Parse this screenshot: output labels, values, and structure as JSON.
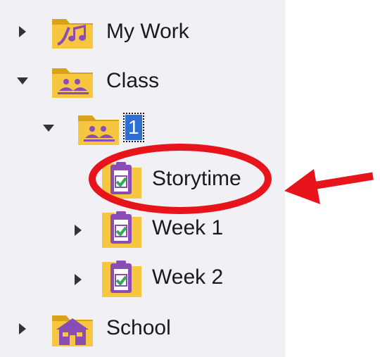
{
  "tree": {
    "items": [
      {
        "label": "My Work",
        "icon": "art-folder-icon",
        "expanded": false
      },
      {
        "label": "Class",
        "icon": "class-folder-icon",
        "expanded": true
      },
      {
        "label": "1",
        "icon": "class-folder-icon",
        "expanded": true,
        "selected": true
      },
      {
        "label": "Storytime",
        "icon": "assignment-clipboard-icon"
      },
      {
        "label": "Week 1",
        "icon": "assignment-clipboard-icon",
        "expanded": false
      },
      {
        "label": "Week 2",
        "icon": "assignment-clipboard-icon",
        "expanded": false
      },
      {
        "label": "School",
        "icon": "school-folder-icon",
        "expanded": false
      }
    ]
  },
  "annotation": {
    "color": "#e8141b",
    "shapes": [
      "highlight-ellipse",
      "pointer-arrow"
    ]
  },
  "colors": {
    "folder": "#f6c640",
    "folder_dark": "#d9a21a",
    "purple": "#8a4cb5",
    "check": "#33a853",
    "selection": "#2d6fd0"
  }
}
